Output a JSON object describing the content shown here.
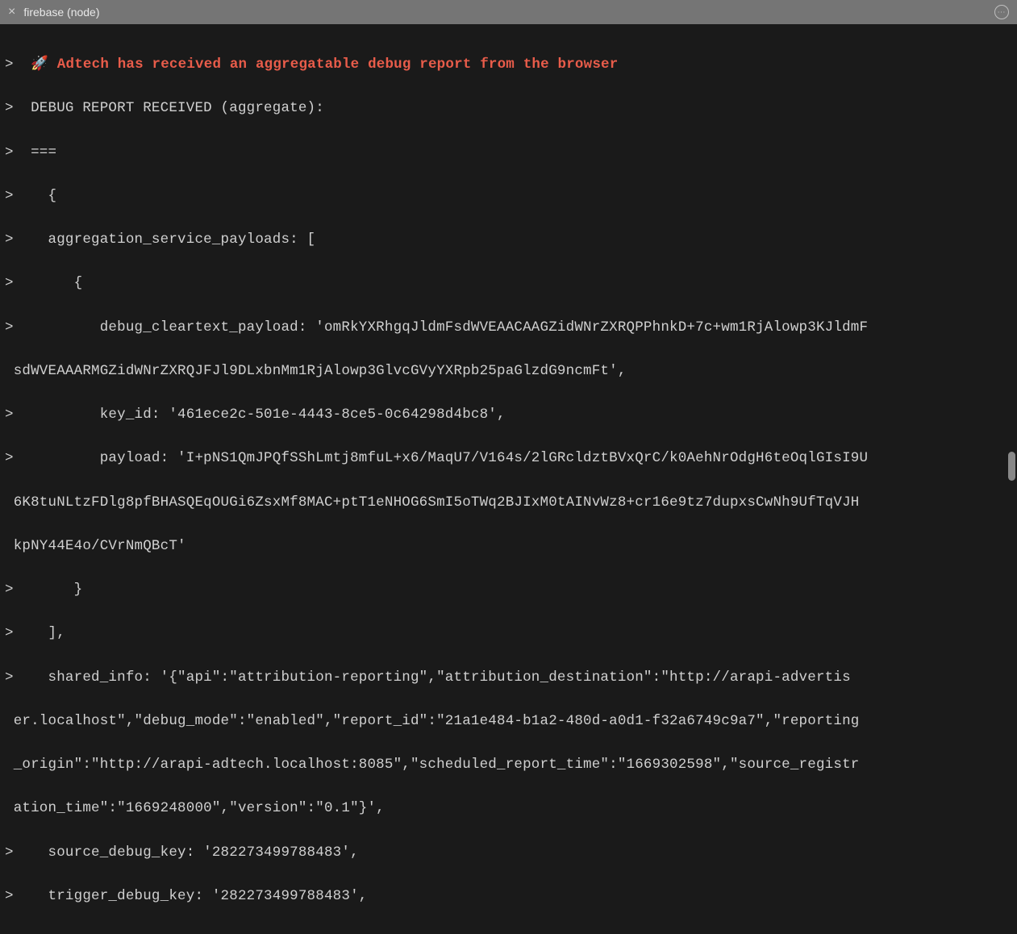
{
  "titlebar": {
    "title": "firebase (node)",
    "close_glyph": "×",
    "more_glyph": "⋯"
  },
  "console": {
    "prompt": ">",
    "rocket": "🚀",
    "highlight": " Adtech has received an aggregatable debug report from the browser",
    "lines": {
      "l2": "  DEBUG REPORT RECEIVED (aggregate):",
      "l3": "  ===",
      "l4": "    {",
      "l5": "    aggregation_service_payloads: [",
      "l6": "       {",
      "l7a": "          debug_cleartext_payload: 'omRkYXRhgqJldmFsdWVEAACAAGZidWNrZXRQPPhnkD+7c+wm1RjAlowp3KJldmF",
      "l7b": " sdWVEAAARMGZidWNrZXRQJFJl9DLxbnMm1RjAlowp3GlvcGVyYXRpb25paGlzdG9ncmFt',",
      "l8": "          key_id: '461ece2c-501e-4443-8ce5-0c64298d4bc8',",
      "l9a": "          payload: 'I+pNS1QmJPQfSShLmtj8mfuL+x6/MaqU7/V164s/2lGRcldztBVxQrC/k0AehNrOdgH6teOqlGIsI9U",
      "l9b": " 6K8tuNLtzFDlg8pfBHASQEqOUGi6ZsxMf8MAC+ptT1eNHOG6SmI5oTWq2BJIxM0tAINvWz8+cr16e9tz7dupxsCwNh9UfTqVJH",
      "l9c": " kpNY44E4o/CVrNmQBcT'",
      "l10": "       }",
      "l11": "    ],",
      "l12a": "    shared_info: '{\"api\":\"attribution-reporting\",\"attribution_destination\":\"http://arapi-advertis",
      "l12b": " er.localhost\",\"debug_mode\":\"enabled\",\"report_id\":\"21a1e484-b1a2-480d-a0d1-f32a6749c9a7\",\"reporting",
      "l12c": " _origin\":\"http://arapi-adtech.localhost:8085\",\"scheduled_report_time\":\"1669302598\",\"source_registr",
      "l12d": " ation_time\":\"1669248000\",\"version\":\"0.1\"}',",
      "l13": "    source_debug_key: '282273499788483',",
      "l14": "    trigger_debug_key: '282273499788483',"
    }
  }
}
